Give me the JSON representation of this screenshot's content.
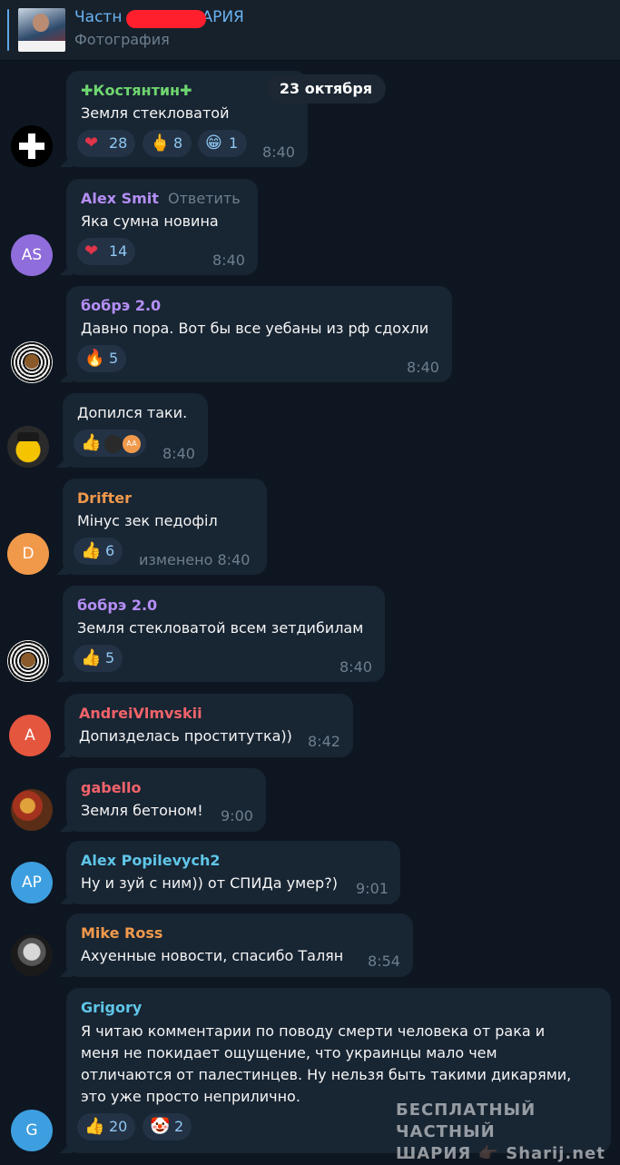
{
  "header": {
    "title_start": "Частн",
    "title_end": "АРИЯ",
    "subtitle": "Фотография"
  },
  "date_pill": "23 октября",
  "messages": [
    {
      "name": "✚Костянтин✚",
      "text": "Земля стекловатой",
      "time": "8:40",
      "name_color": "#6fd66f",
      "reactions": [
        {
          "icon": "heart",
          "emoji": "❤",
          "count": "28"
        },
        {
          "icon": "middle-finger",
          "emoji": "🖕",
          "count": "8"
        },
        {
          "icon": "grinning-face",
          "emoji": "😁",
          "count": "1"
        }
      ]
    },
    {
      "name": "Alex Smit",
      "reply": "Ответить",
      "text": "Яка сумна новина",
      "time": "8:40",
      "avatar": "AS",
      "avatar_color": "#8f6ddb",
      "name_color": "#b48ef5",
      "reactions": [
        {
          "icon": "heart",
          "emoji": "❤",
          "count": "14"
        }
      ]
    },
    {
      "name": "бобрэ 2.0",
      "text": "Давно пора. Вот бы все уебаны из рф сдохли",
      "time": "8:40",
      "name_color": "#b48ef5",
      "reactions": [
        {
          "icon": "fire",
          "emoji": "🔥",
          "count": "5"
        }
      ]
    },
    {
      "text": "Допился таки.",
      "time": "8:40",
      "reactions": [
        {
          "icon": "thumbs-up",
          "emoji": "👍",
          "avatars": [
            "",
            "AA"
          ]
        }
      ]
    },
    {
      "name": "Drifter",
      "text": "Мінус зек педофіл",
      "time": "изменено 8:40",
      "avatar": "D",
      "avatar_color": "#f0994b",
      "name_color": "#f0994b",
      "reactions": [
        {
          "icon": "thumbs-up",
          "emoji": "👍",
          "count": "6"
        }
      ]
    },
    {
      "name": "бобрэ 2.0",
      "text": "Земля стекловатой всем зетдибилам",
      "time": "8:40",
      "name_color": "#b48ef5",
      "reactions": [
        {
          "icon": "thumbs-up",
          "emoji": "👍",
          "count": "5"
        }
      ]
    },
    {
      "name": "AndreiVlmvskii",
      "text": "Допизделась проститутка))",
      "time": "8:42",
      "avatar": "A",
      "avatar_color": "#e5563f",
      "name_color": "#f2636a"
    },
    {
      "name": "gabello",
      "text": "Земля бетоном!",
      "time": "9:00",
      "name_color": "#f2636a"
    },
    {
      "name": "Alex Popilevych2",
      "text": "Ну и зуй с ним)) от СПИДа умер?)",
      "time": "9:01",
      "avatar": "AP",
      "avatar_color": "#3d9fe0",
      "name_color": "#5fc6e8"
    },
    {
      "name": "Mike Ross",
      "text": "Ахуенные новости, спасибо Талян",
      "time": "8:54",
      "name_color": "#f0994b"
    },
    {
      "name": "Grigory",
      "time": "",
      "avatar": "G",
      "avatar_color": "#3d9fe0",
      "name_color": "#5fc6e8",
      "text_lines": [
        "Я читаю комментарии по поводу смерти человека от рака и",
        "меня не покидает ощущение, что украинцы мало чем",
        "отличаются от палестинцев. Ну нельзя быть такими дикарями,",
        "это уже просто неприлично."
      ],
      "reactions": [
        {
          "icon": "thumbs-up",
          "emoji": "👍",
          "count": "20"
        },
        {
          "icon": "clown-face",
          "emoji": "🤡",
          "count": "2"
        }
      ]
    }
  ],
  "watermark": {
    "line1": "БЕСПЛАТНЫЙ ЧАСТНЫЙ",
    "line2": "ШАРИЯ 👉🏿 Sharij.net"
  },
  "colors": {
    "background": "#0e1621",
    "bubble": "#182533",
    "header": "#17212b",
    "link": "#6ab3f3"
  }
}
